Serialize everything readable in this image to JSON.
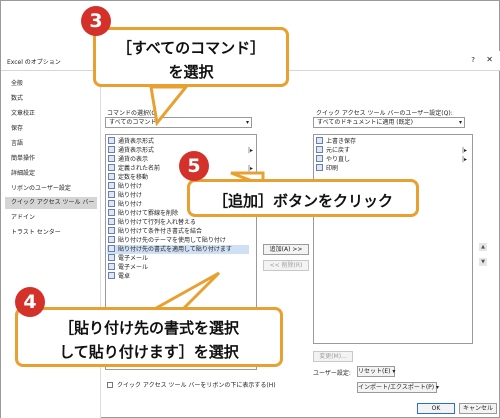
{
  "window": {
    "title": "Excel のオプション",
    "help_glyph": "?",
    "close_glyph": "✕"
  },
  "sidebar": {
    "items": [
      {
        "label": "全般"
      },
      {
        "label": "数式"
      },
      {
        "label": "文章校正"
      },
      {
        "label": "保存"
      },
      {
        "label": "言語"
      },
      {
        "label": "簡単操作"
      },
      {
        "label": "詳細設定"
      },
      {
        "label": "リボンのユーザー設定"
      },
      {
        "label": "クイック アクセス ツール バー"
      },
      {
        "label": "アドイン"
      },
      {
        "label": "トラスト センター"
      }
    ]
  },
  "left_panel": {
    "command_label": "コマンドの選択(C):",
    "command_value": "すべてのコマンド",
    "items": [
      {
        "label": "通貨表示形式"
      },
      {
        "label": "通貨表示形式",
        "has_sub": true
      },
      {
        "label": "通貨の表示"
      },
      {
        "label": "定義された名前",
        "has_sub": true
      },
      {
        "label": "定数を移動"
      },
      {
        "label": "貼り付け"
      },
      {
        "label": "貼り付け",
        "has_sub": true
      },
      {
        "label": "貼り付け"
      },
      {
        "label": "貼り付けて罫線を削除"
      },
      {
        "label": "貼り付けて行列を入れ替える"
      },
      {
        "label": "貼り付けて条件付き書式を結合"
      },
      {
        "label": "貼り付け先のテーマを使用して貼り付け"
      },
      {
        "label": "貼り付け先の書式を適用して貼り付けます",
        "selected": true
      },
      {
        "label": "電子メール"
      },
      {
        "label": "電子メール"
      },
      {
        "label": "電卓"
      }
    ]
  },
  "right_panel": {
    "qat_label": "クイック アクセス ツール バーのユーザー設定(Q):",
    "qat_value": "すべてのドキュメントに適用 (既定)",
    "items": [
      {
        "label": "上書き保存"
      },
      {
        "label": "元に戻す",
        "has_sub": true
      },
      {
        "label": "やり直し",
        "has_sub": true
      },
      {
        "label": "印刷"
      }
    ],
    "modify_button": "変更(M)...",
    "user_settings_label": "ユーザー設定:",
    "reset_button": "リセット(E) ▾",
    "import_export_button": "インポート/エクスポート(P) ▾"
  },
  "middle": {
    "add_button": "追加(A) >>",
    "remove_button": "<< 削除(R)"
  },
  "bottom": {
    "checkbox_label": "クイック アクセス ツール バーをリボンの下に表示する(H)",
    "ok_button": "OK",
    "cancel_button": "キャンセル"
  },
  "callouts": {
    "c3_number": "3",
    "c3_line1": "［すべてのコマンド］",
    "c3_line2": "を選択",
    "c5_number": "5",
    "c5_text": "［追加］ボタンをクリック",
    "c4_number": "4",
    "c4_line1": "［貼り付け先の書式を選択",
    "c4_line2": "して貼り付けます］を選択"
  },
  "colors": {
    "callout_border": "#e8a030",
    "number_badge": "#d3312a",
    "selection": "#cfe0f5"
  }
}
